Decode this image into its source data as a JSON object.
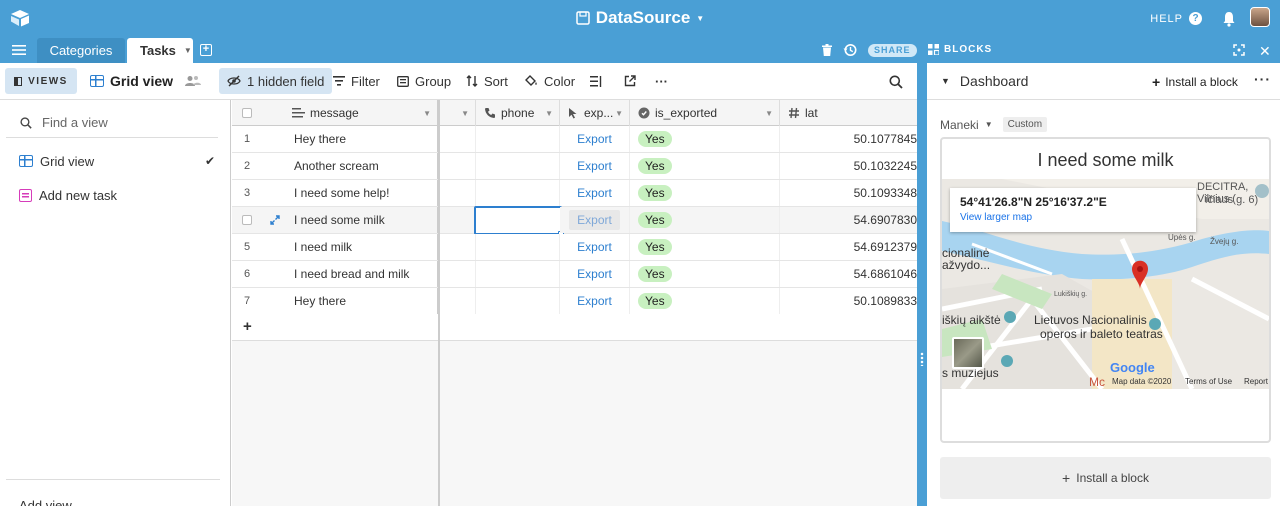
{
  "app": {
    "title": "DataSource",
    "help": "HELP",
    "share": "SHARE",
    "blocks": "BLOCKS"
  },
  "tabs": [
    {
      "label": "Categories"
    },
    {
      "label": "Tasks"
    }
  ],
  "toolbar": {
    "views": "VIEWS",
    "view_name": "Grid view",
    "hidden_field": "1 hidden field",
    "filter": "Filter",
    "group": "Group",
    "sort": "Sort",
    "color": "Color",
    "more": "···"
  },
  "sidebar": {
    "find_placeholder": "Find a view",
    "items": [
      {
        "label": "Grid view",
        "icon": "grid-icon"
      },
      {
        "label": "Add new task",
        "icon": "form-icon"
      }
    ],
    "add_view": "Add view"
  },
  "columns": {
    "message": "message",
    "phone": "phone",
    "exported": "exp...",
    "is_exported": "is_exported",
    "lat": "lat"
  },
  "rows": [
    {
      "n": "1",
      "message": "Hey there",
      "export": "Export",
      "is_exported": "Yes",
      "lat": "50.1077845"
    },
    {
      "n": "2",
      "message": "Another scream",
      "export": "Export",
      "is_exported": "Yes",
      "lat": "50.1032245"
    },
    {
      "n": "3",
      "message": "I need some help!",
      "export": "Export",
      "is_exported": "Yes",
      "lat": "50.1093348"
    },
    {
      "n": "4",
      "message": "I need some milk",
      "export": "Export",
      "is_exported": "Yes",
      "lat": "54.6907830"
    },
    {
      "n": "5",
      "message": "I need milk",
      "export": "Export",
      "is_exported": "Yes",
      "lat": "54.6912379"
    },
    {
      "n": "6",
      "message": "I need bread and milk",
      "export": "Export",
      "is_exported": "Yes",
      "lat": "54.6861046"
    },
    {
      "n": "7",
      "message": "Hey there",
      "export": "Export",
      "is_exported": "Yes",
      "lat": "50.1089833"
    }
  ],
  "add_row": "+",
  "dashboard": {
    "title": "Dashboard",
    "install": "Install a block",
    "more": "···",
    "maneki": "Maneki",
    "custom": "Custom",
    "block_title": "I need some milk",
    "map": {
      "coords": "54°41'26.8\"N 25°16'37.2\"E",
      "larger": "View larger map",
      "poi1": "DECITRA, Vilnius (",
      "poi2": "ičiaus g. 6)",
      "street1": "Upės g.",
      "street2": "Žvejų g.",
      "street3": "Lukiškių g.",
      "label1": "cionalinė",
      "label2": "ažvydo...",
      "label3": "iškių aikštė",
      "label4": "Lietuvos Nacionalinis",
      "label5": "operos ir baleto teatras",
      "label6": "s muziejus",
      "label7": "Mc",
      "google": "Google",
      "data": "Map data ©2020",
      "terms": "Terms of Use",
      "report": "Report"
    },
    "install_bottom": "Install a block"
  }
}
